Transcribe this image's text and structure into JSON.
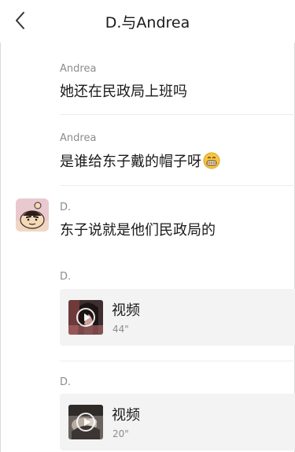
{
  "header": {
    "title": "D.与Andrea",
    "back_icon": "chevron-left-icon"
  },
  "messages": [
    {
      "sender": "Andrea",
      "text": "她还在民政局上班吗"
    },
    {
      "sender": "Andrea",
      "text": "是谁给东子戴的帽子呀",
      "emoji": "grinning-face-emoji"
    },
    {
      "sender": "D.",
      "text": "东子说就是他们民政局的"
    },
    {
      "sender": "D.",
      "type": "video",
      "label": "视频",
      "duration": "44\""
    },
    {
      "sender": "D.",
      "type": "video",
      "label": "视频",
      "duration": "20\""
    }
  ],
  "colors": {
    "text": "#1a1a1a",
    "secondary": "#8c8c8c",
    "card_bg": "#f3f3f3",
    "divider": "#ececec"
  }
}
